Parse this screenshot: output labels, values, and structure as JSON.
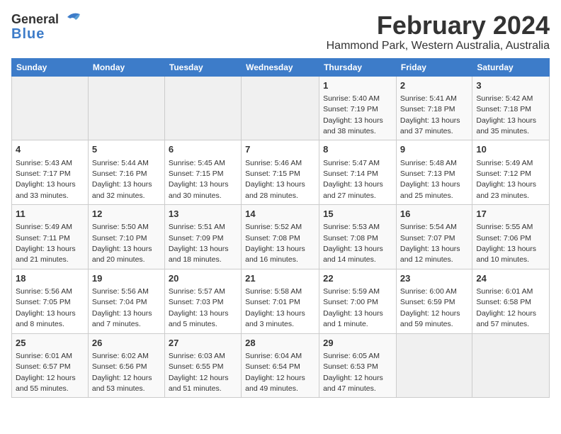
{
  "header": {
    "logo_line1": "General",
    "logo_line2": "Blue",
    "title": "February 2024",
    "subtitle": "Hammond Park, Western Australia, Australia"
  },
  "days_of_week": [
    "Sunday",
    "Monday",
    "Tuesday",
    "Wednesday",
    "Thursday",
    "Friday",
    "Saturday"
  ],
  "weeks": [
    [
      {
        "num": "",
        "detail": ""
      },
      {
        "num": "",
        "detail": ""
      },
      {
        "num": "",
        "detail": ""
      },
      {
        "num": "",
        "detail": ""
      },
      {
        "num": "1",
        "detail": "Sunrise: 5:40 AM\nSunset: 7:19 PM\nDaylight: 13 hours\nand 38 minutes."
      },
      {
        "num": "2",
        "detail": "Sunrise: 5:41 AM\nSunset: 7:18 PM\nDaylight: 13 hours\nand 37 minutes."
      },
      {
        "num": "3",
        "detail": "Sunrise: 5:42 AM\nSunset: 7:18 PM\nDaylight: 13 hours\nand 35 minutes."
      }
    ],
    [
      {
        "num": "4",
        "detail": "Sunrise: 5:43 AM\nSunset: 7:17 PM\nDaylight: 13 hours\nand 33 minutes."
      },
      {
        "num": "5",
        "detail": "Sunrise: 5:44 AM\nSunset: 7:16 PM\nDaylight: 13 hours\nand 32 minutes."
      },
      {
        "num": "6",
        "detail": "Sunrise: 5:45 AM\nSunset: 7:15 PM\nDaylight: 13 hours\nand 30 minutes."
      },
      {
        "num": "7",
        "detail": "Sunrise: 5:46 AM\nSunset: 7:15 PM\nDaylight: 13 hours\nand 28 minutes."
      },
      {
        "num": "8",
        "detail": "Sunrise: 5:47 AM\nSunset: 7:14 PM\nDaylight: 13 hours\nand 27 minutes."
      },
      {
        "num": "9",
        "detail": "Sunrise: 5:48 AM\nSunset: 7:13 PM\nDaylight: 13 hours\nand 25 minutes."
      },
      {
        "num": "10",
        "detail": "Sunrise: 5:49 AM\nSunset: 7:12 PM\nDaylight: 13 hours\nand 23 minutes."
      }
    ],
    [
      {
        "num": "11",
        "detail": "Sunrise: 5:49 AM\nSunset: 7:11 PM\nDaylight: 13 hours\nand 21 minutes."
      },
      {
        "num": "12",
        "detail": "Sunrise: 5:50 AM\nSunset: 7:10 PM\nDaylight: 13 hours\nand 20 minutes."
      },
      {
        "num": "13",
        "detail": "Sunrise: 5:51 AM\nSunset: 7:09 PM\nDaylight: 13 hours\nand 18 minutes."
      },
      {
        "num": "14",
        "detail": "Sunrise: 5:52 AM\nSunset: 7:08 PM\nDaylight: 13 hours\nand 16 minutes."
      },
      {
        "num": "15",
        "detail": "Sunrise: 5:53 AM\nSunset: 7:08 PM\nDaylight: 13 hours\nand 14 minutes."
      },
      {
        "num": "16",
        "detail": "Sunrise: 5:54 AM\nSunset: 7:07 PM\nDaylight: 13 hours\nand 12 minutes."
      },
      {
        "num": "17",
        "detail": "Sunrise: 5:55 AM\nSunset: 7:06 PM\nDaylight: 13 hours\nand 10 minutes."
      }
    ],
    [
      {
        "num": "18",
        "detail": "Sunrise: 5:56 AM\nSunset: 7:05 PM\nDaylight: 13 hours\nand 8 minutes."
      },
      {
        "num": "19",
        "detail": "Sunrise: 5:56 AM\nSunset: 7:04 PM\nDaylight: 13 hours\nand 7 minutes."
      },
      {
        "num": "20",
        "detail": "Sunrise: 5:57 AM\nSunset: 7:03 PM\nDaylight: 13 hours\nand 5 minutes."
      },
      {
        "num": "21",
        "detail": "Sunrise: 5:58 AM\nSunset: 7:01 PM\nDaylight: 13 hours\nand 3 minutes."
      },
      {
        "num": "22",
        "detail": "Sunrise: 5:59 AM\nSunset: 7:00 PM\nDaylight: 13 hours\nand 1 minute."
      },
      {
        "num": "23",
        "detail": "Sunrise: 6:00 AM\nSunset: 6:59 PM\nDaylight: 12 hours\nand 59 minutes."
      },
      {
        "num": "24",
        "detail": "Sunrise: 6:01 AM\nSunset: 6:58 PM\nDaylight: 12 hours\nand 57 minutes."
      }
    ],
    [
      {
        "num": "25",
        "detail": "Sunrise: 6:01 AM\nSunset: 6:57 PM\nDaylight: 12 hours\nand 55 minutes."
      },
      {
        "num": "26",
        "detail": "Sunrise: 6:02 AM\nSunset: 6:56 PM\nDaylight: 12 hours\nand 53 minutes."
      },
      {
        "num": "27",
        "detail": "Sunrise: 6:03 AM\nSunset: 6:55 PM\nDaylight: 12 hours\nand 51 minutes."
      },
      {
        "num": "28",
        "detail": "Sunrise: 6:04 AM\nSunset: 6:54 PM\nDaylight: 12 hours\nand 49 minutes."
      },
      {
        "num": "29",
        "detail": "Sunrise: 6:05 AM\nSunset: 6:53 PM\nDaylight: 12 hours\nand 47 minutes."
      },
      {
        "num": "",
        "detail": ""
      },
      {
        "num": "",
        "detail": ""
      }
    ]
  ]
}
